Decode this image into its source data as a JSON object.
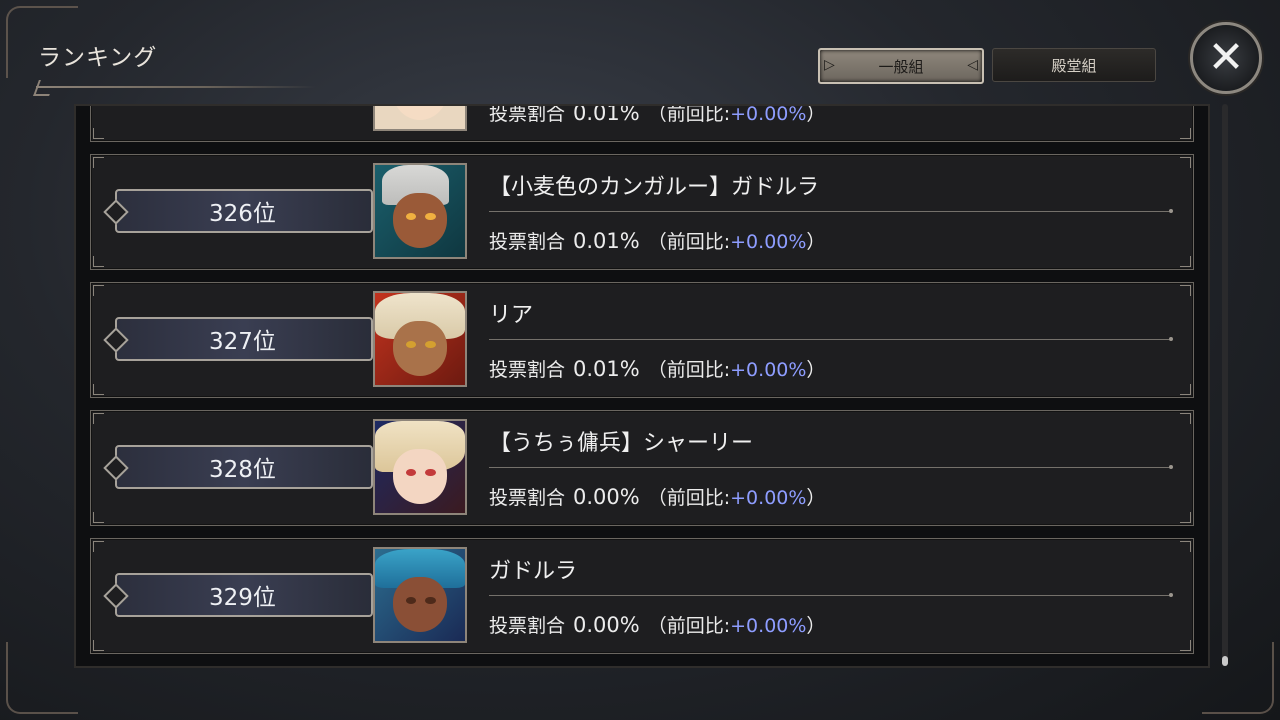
{
  "header": {
    "title": "ランキング",
    "tabs": [
      {
        "label": "一般組",
        "active": true
      },
      {
        "label": "殿堂組",
        "active": false
      }
    ],
    "close_label": "✕"
  },
  "colors": {
    "delta_positive": "#8e9dff",
    "active_tab": "#8f877c"
  },
  "partial_row": {
    "stats_label": "投票割合",
    "share": "0.01%",
    "prev_open": "（前回比:",
    "delta": "+0.00%",
    "prev_close": "）"
  },
  "rankings": [
    {
      "rank": "326位",
      "name": "【小麦色のカンガルー】ガドルラ",
      "stats_label": "投票割合",
      "share": "0.01%",
      "prev_open": "（前回比:",
      "delta": "+0.00%",
      "prev_close": "）"
    },
    {
      "rank": "327位",
      "name": "リア",
      "stats_label": "投票割合",
      "share": "0.01%",
      "prev_open": "（前回比:",
      "delta": "+0.00%",
      "prev_close": "）"
    },
    {
      "rank": "328位",
      "name": "【うちぅ傭兵】シャーリー",
      "stats_label": "投票割合",
      "share": "0.00%",
      "prev_open": "（前回比:",
      "delta": "+0.00%",
      "prev_close": "）"
    },
    {
      "rank": "329位",
      "name": "ガドルラ",
      "stats_label": "投票割合",
      "share": "0.00%",
      "prev_open": "（前回比:",
      "delta": "+0.00%",
      "prev_close": "）"
    }
  ]
}
